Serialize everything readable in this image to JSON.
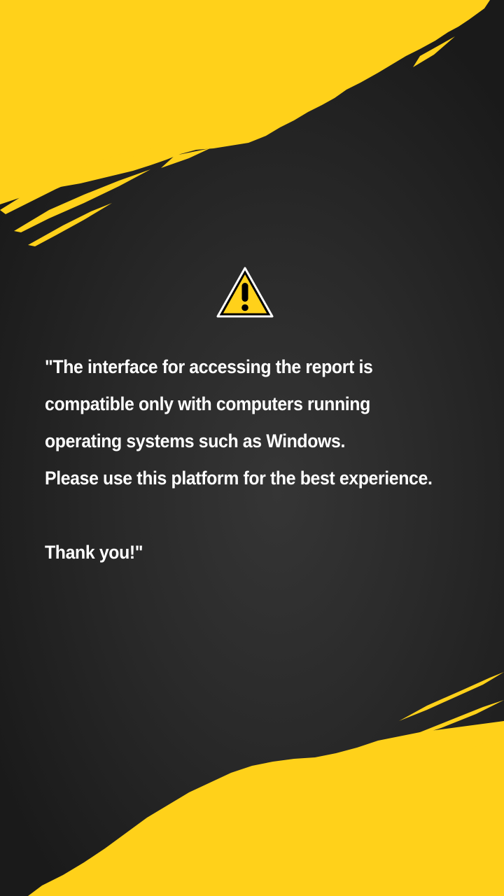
{
  "notice": {
    "icon": "warning-icon",
    "lines": [
      "\"The interface for accessing the report is",
      "compatible only with computers running",
      "operating systems such as Windows.",
      "Please use this platform for the best experience."
    ],
    "closing": "Thank you!\""
  },
  "colors": {
    "accent": "#FFD11A",
    "background": "#2B2B2B",
    "text": "#FFFFFF"
  }
}
